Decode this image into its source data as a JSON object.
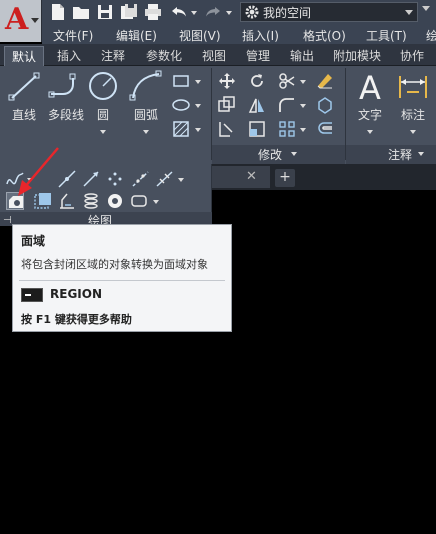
{
  "quick_access": {
    "workspace_name": "我的空间",
    "icons": [
      "new-file-icon",
      "open-folder-icon",
      "save-icon",
      "save-as-icon",
      "print-icon",
      "undo-icon",
      "redo-icon"
    ]
  },
  "menu": {
    "items": [
      "文件(F)",
      "编辑(E)",
      "视图(V)",
      "插入(I)",
      "格式(O)",
      "工具(T)",
      "绘"
    ]
  },
  "ribbon": {
    "tabs": [
      "默认",
      "插入",
      "注释",
      "参数化",
      "视图",
      "管理",
      "输出",
      "附加模块",
      "协作"
    ],
    "active_tab": "默认",
    "draw_tools": [
      "直线",
      "多段线",
      "圆",
      "圆弧"
    ],
    "annotation_tools": [
      "文字",
      "标注"
    ],
    "panels": {
      "modify": "修改",
      "annotation": "注释",
      "draw": "绘图"
    }
  },
  "tooltip": {
    "title": "面域",
    "description": "将包含封闭区域的对象转换为面域对象",
    "command": "REGION",
    "help": "按 F1 键获得更多帮助"
  },
  "colors": {
    "ribbon_bg": "#48505e",
    "titlebar_bg": "#3b4453",
    "canvas_bg": "#000000",
    "tooltip_bg": "#f4f5f7",
    "annotation_arrow": "#e8262b",
    "logo_red": "#cc1f1f"
  }
}
